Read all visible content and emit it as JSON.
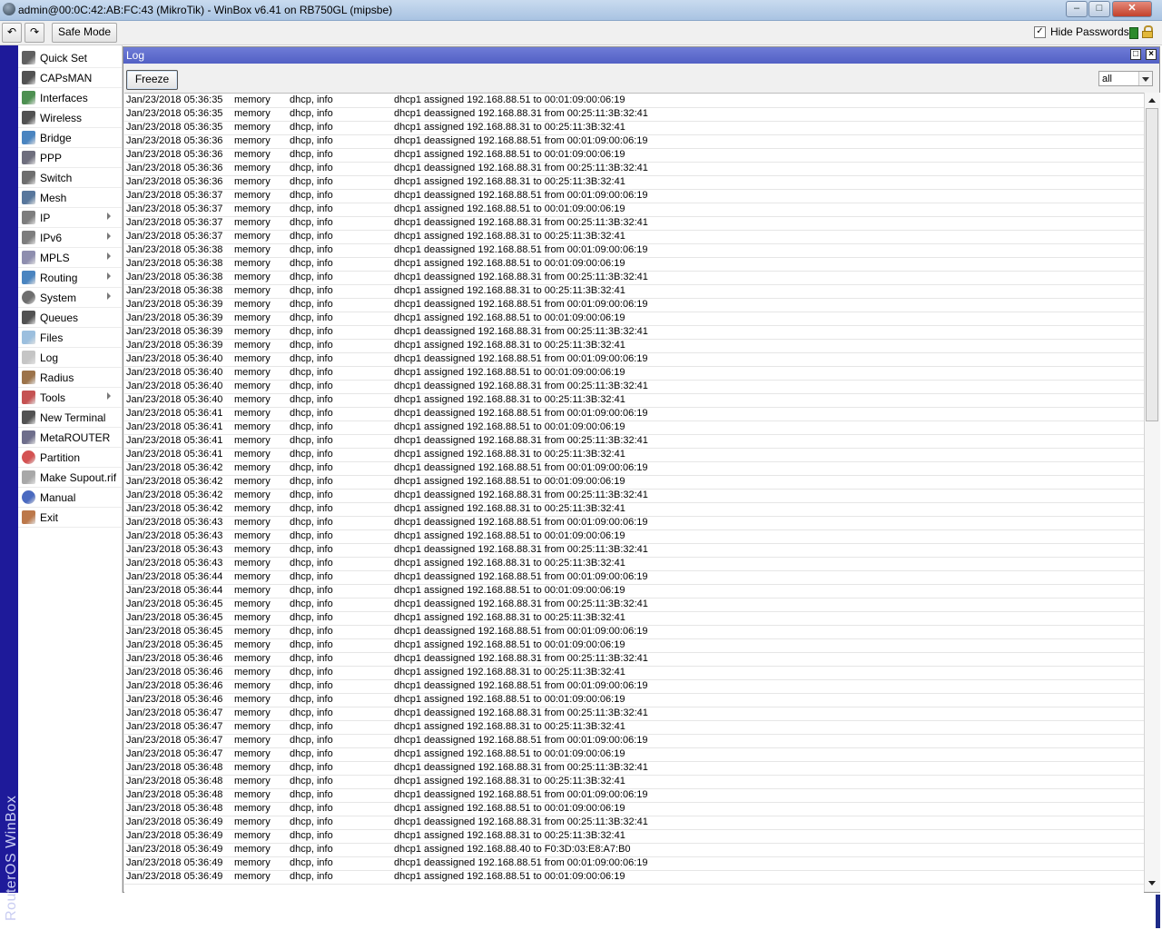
{
  "window": {
    "title": "admin@00:0C:42:AB:FC:43 (MikroTik) - WinBox v6.41 on RB750GL (mipsbe)",
    "minimize_icon": "minimize-icon",
    "maximize_icon": "maximize-icon",
    "close_icon": "close-icon"
  },
  "toolbar": {
    "undo_icon": "undo-icon",
    "redo_icon": "redo-icon",
    "safe_mode_label": "Safe Mode",
    "hide_passwords_label": "Hide Passwords",
    "hide_passwords_checked": true
  },
  "brand": {
    "text": "RouterOS WinBox"
  },
  "sidebar": {
    "items": [
      {
        "label": "Quick Set",
        "icon": "wand-icon",
        "submenu": false
      },
      {
        "label": "CAPsMAN",
        "icon": "antenna-icon",
        "submenu": false
      },
      {
        "label": "Interfaces",
        "icon": "interfaces-icon",
        "submenu": false
      },
      {
        "label": "Wireless",
        "icon": "wireless-icon",
        "submenu": false
      },
      {
        "label": "Bridge",
        "icon": "bridge-icon",
        "submenu": false
      },
      {
        "label": "PPP",
        "icon": "ppp-icon",
        "submenu": false
      },
      {
        "label": "Switch",
        "icon": "switch-icon",
        "submenu": false
      },
      {
        "label": "Mesh",
        "icon": "mesh-icon",
        "submenu": false
      },
      {
        "label": "IP",
        "icon": "ip-icon",
        "submenu": true
      },
      {
        "label": "IPv6",
        "icon": "ipv6-icon",
        "submenu": true
      },
      {
        "label": "MPLS",
        "icon": "mpls-icon",
        "submenu": true
      },
      {
        "label": "Routing",
        "icon": "routing-icon",
        "submenu": true
      },
      {
        "label": "System",
        "icon": "gear-icon",
        "submenu": true
      },
      {
        "label": "Queues",
        "icon": "queues-icon",
        "submenu": false
      },
      {
        "label": "Files",
        "icon": "folder-icon",
        "submenu": false
      },
      {
        "label": "Log",
        "icon": "log-icon",
        "submenu": false
      },
      {
        "label": "Radius",
        "icon": "radius-icon",
        "submenu": false
      },
      {
        "label": "Tools",
        "icon": "tools-icon",
        "submenu": true
      },
      {
        "label": "New Terminal",
        "icon": "terminal-icon",
        "submenu": false
      },
      {
        "label": "MetaROUTER",
        "icon": "metarouter-icon",
        "submenu": false
      },
      {
        "label": "Partition",
        "icon": "partition-icon",
        "submenu": false
      },
      {
        "label": "Make Supout.rif",
        "icon": "supout-icon",
        "submenu": false
      },
      {
        "label": "Manual",
        "icon": "help-icon",
        "submenu": false
      },
      {
        "label": "Exit",
        "icon": "exit-icon",
        "submenu": false
      }
    ]
  },
  "log_window": {
    "title": "Log",
    "freeze_label": "Freeze",
    "filter_value": "all",
    "rows": [
      [
        "Jan/23/2018 05:36:35",
        "memory",
        "dhcp, info",
        "dhcp1 assigned 192.168.88.51 to 00:01:09:00:06:19"
      ],
      [
        "Jan/23/2018 05:36:35",
        "memory",
        "dhcp, info",
        "dhcp1 deassigned 192.168.88.31 from 00:25:11:3B:32:41"
      ],
      [
        "Jan/23/2018 05:36:35",
        "memory",
        "dhcp, info",
        "dhcp1 assigned 192.168.88.31 to 00:25:11:3B:32:41"
      ],
      [
        "Jan/23/2018 05:36:36",
        "memory",
        "dhcp, info",
        "dhcp1 deassigned 192.168.88.51 from 00:01:09:00:06:19"
      ],
      [
        "Jan/23/2018 05:36:36",
        "memory",
        "dhcp, info",
        "dhcp1 assigned 192.168.88.51 to 00:01:09:00:06:19"
      ],
      [
        "Jan/23/2018 05:36:36",
        "memory",
        "dhcp, info",
        "dhcp1 deassigned 192.168.88.31 from 00:25:11:3B:32:41"
      ],
      [
        "Jan/23/2018 05:36:36",
        "memory",
        "dhcp, info",
        "dhcp1 assigned 192.168.88.31 to 00:25:11:3B:32:41"
      ],
      [
        "Jan/23/2018 05:36:37",
        "memory",
        "dhcp, info",
        "dhcp1 deassigned 192.168.88.51 from 00:01:09:00:06:19"
      ],
      [
        "Jan/23/2018 05:36:37",
        "memory",
        "dhcp, info",
        "dhcp1 assigned 192.168.88.51 to 00:01:09:00:06:19"
      ],
      [
        "Jan/23/2018 05:36:37",
        "memory",
        "dhcp, info",
        "dhcp1 deassigned 192.168.88.31 from 00:25:11:3B:32:41"
      ],
      [
        "Jan/23/2018 05:36:37",
        "memory",
        "dhcp, info",
        "dhcp1 assigned 192.168.88.31 to 00:25:11:3B:32:41"
      ],
      [
        "Jan/23/2018 05:36:38",
        "memory",
        "dhcp, info",
        "dhcp1 deassigned 192.168.88.51 from 00:01:09:00:06:19"
      ],
      [
        "Jan/23/2018 05:36:38",
        "memory",
        "dhcp, info",
        "dhcp1 assigned 192.168.88.51 to 00:01:09:00:06:19"
      ],
      [
        "Jan/23/2018 05:36:38",
        "memory",
        "dhcp, info",
        "dhcp1 deassigned 192.168.88.31 from 00:25:11:3B:32:41"
      ],
      [
        "Jan/23/2018 05:36:38",
        "memory",
        "dhcp, info",
        "dhcp1 assigned 192.168.88.31 to 00:25:11:3B:32:41"
      ],
      [
        "Jan/23/2018 05:36:39",
        "memory",
        "dhcp, info",
        "dhcp1 deassigned 192.168.88.51 from 00:01:09:00:06:19"
      ],
      [
        "Jan/23/2018 05:36:39",
        "memory",
        "dhcp, info",
        "dhcp1 assigned 192.168.88.51 to 00:01:09:00:06:19"
      ],
      [
        "Jan/23/2018 05:36:39",
        "memory",
        "dhcp, info",
        "dhcp1 deassigned 192.168.88.31 from 00:25:11:3B:32:41"
      ],
      [
        "Jan/23/2018 05:36:39",
        "memory",
        "dhcp, info",
        "dhcp1 assigned 192.168.88.31 to 00:25:11:3B:32:41"
      ],
      [
        "Jan/23/2018 05:36:40",
        "memory",
        "dhcp, info",
        "dhcp1 deassigned 192.168.88.51 from 00:01:09:00:06:19"
      ],
      [
        "Jan/23/2018 05:36:40",
        "memory",
        "dhcp, info",
        "dhcp1 assigned 192.168.88.51 to 00:01:09:00:06:19"
      ],
      [
        "Jan/23/2018 05:36:40",
        "memory",
        "dhcp, info",
        "dhcp1 deassigned 192.168.88.31 from 00:25:11:3B:32:41"
      ],
      [
        "Jan/23/2018 05:36:40",
        "memory",
        "dhcp, info",
        "dhcp1 assigned 192.168.88.31 to 00:25:11:3B:32:41"
      ],
      [
        "Jan/23/2018 05:36:41",
        "memory",
        "dhcp, info",
        "dhcp1 deassigned 192.168.88.51 from 00:01:09:00:06:19"
      ],
      [
        "Jan/23/2018 05:36:41",
        "memory",
        "dhcp, info",
        "dhcp1 assigned 192.168.88.51 to 00:01:09:00:06:19"
      ],
      [
        "Jan/23/2018 05:36:41",
        "memory",
        "dhcp, info",
        "dhcp1 deassigned 192.168.88.31 from 00:25:11:3B:32:41"
      ],
      [
        "Jan/23/2018 05:36:41",
        "memory",
        "dhcp, info",
        "dhcp1 assigned 192.168.88.31 to 00:25:11:3B:32:41"
      ],
      [
        "Jan/23/2018 05:36:42",
        "memory",
        "dhcp, info",
        "dhcp1 deassigned 192.168.88.51 from 00:01:09:00:06:19"
      ],
      [
        "Jan/23/2018 05:36:42",
        "memory",
        "dhcp, info",
        "dhcp1 assigned 192.168.88.51 to 00:01:09:00:06:19"
      ],
      [
        "Jan/23/2018 05:36:42",
        "memory",
        "dhcp, info",
        "dhcp1 deassigned 192.168.88.31 from 00:25:11:3B:32:41"
      ],
      [
        "Jan/23/2018 05:36:42",
        "memory",
        "dhcp, info",
        "dhcp1 assigned 192.168.88.31 to 00:25:11:3B:32:41"
      ],
      [
        "Jan/23/2018 05:36:43",
        "memory",
        "dhcp, info",
        "dhcp1 deassigned 192.168.88.51 from 00:01:09:00:06:19"
      ],
      [
        "Jan/23/2018 05:36:43",
        "memory",
        "dhcp, info",
        "dhcp1 assigned 192.168.88.51 to 00:01:09:00:06:19"
      ],
      [
        "Jan/23/2018 05:36:43",
        "memory",
        "dhcp, info",
        "dhcp1 deassigned 192.168.88.31 from 00:25:11:3B:32:41"
      ],
      [
        "Jan/23/2018 05:36:43",
        "memory",
        "dhcp, info",
        "dhcp1 assigned 192.168.88.31 to 00:25:11:3B:32:41"
      ],
      [
        "Jan/23/2018 05:36:44",
        "memory",
        "dhcp, info",
        "dhcp1 deassigned 192.168.88.51 from 00:01:09:00:06:19"
      ],
      [
        "Jan/23/2018 05:36:44",
        "memory",
        "dhcp, info",
        "dhcp1 assigned 192.168.88.51 to 00:01:09:00:06:19"
      ],
      [
        "Jan/23/2018 05:36:45",
        "memory",
        "dhcp, info",
        "dhcp1 deassigned 192.168.88.31 from 00:25:11:3B:32:41"
      ],
      [
        "Jan/23/2018 05:36:45",
        "memory",
        "dhcp, info",
        "dhcp1 assigned 192.168.88.31 to 00:25:11:3B:32:41"
      ],
      [
        "Jan/23/2018 05:36:45",
        "memory",
        "dhcp, info",
        "dhcp1 deassigned 192.168.88.51 from 00:01:09:00:06:19"
      ],
      [
        "Jan/23/2018 05:36:45",
        "memory",
        "dhcp, info",
        "dhcp1 assigned 192.168.88.51 to 00:01:09:00:06:19"
      ],
      [
        "Jan/23/2018 05:36:46",
        "memory",
        "dhcp, info",
        "dhcp1 deassigned 192.168.88.31 from 00:25:11:3B:32:41"
      ],
      [
        "Jan/23/2018 05:36:46",
        "memory",
        "dhcp, info",
        "dhcp1 assigned 192.168.88.31 to 00:25:11:3B:32:41"
      ],
      [
        "Jan/23/2018 05:36:46",
        "memory",
        "dhcp, info",
        "dhcp1 deassigned 192.168.88.51 from 00:01:09:00:06:19"
      ],
      [
        "Jan/23/2018 05:36:46",
        "memory",
        "dhcp, info",
        "dhcp1 assigned 192.168.88.51 to 00:01:09:00:06:19"
      ],
      [
        "Jan/23/2018 05:36:47",
        "memory",
        "dhcp, info",
        "dhcp1 deassigned 192.168.88.31 from 00:25:11:3B:32:41"
      ],
      [
        "Jan/23/2018 05:36:47",
        "memory",
        "dhcp, info",
        "dhcp1 assigned 192.168.88.31 to 00:25:11:3B:32:41"
      ],
      [
        "Jan/23/2018 05:36:47",
        "memory",
        "dhcp, info",
        "dhcp1 deassigned 192.168.88.51 from 00:01:09:00:06:19"
      ],
      [
        "Jan/23/2018 05:36:47",
        "memory",
        "dhcp, info",
        "dhcp1 assigned 192.168.88.51 to 00:01:09:00:06:19"
      ],
      [
        "Jan/23/2018 05:36:48",
        "memory",
        "dhcp, info",
        "dhcp1 deassigned 192.168.88.31 from 00:25:11:3B:32:41"
      ],
      [
        "Jan/23/2018 05:36:48",
        "memory",
        "dhcp, info",
        "dhcp1 assigned 192.168.88.31 to 00:25:11:3B:32:41"
      ],
      [
        "Jan/23/2018 05:36:48",
        "memory",
        "dhcp, info",
        "dhcp1 deassigned 192.168.88.51 from 00:01:09:00:06:19"
      ],
      [
        "Jan/23/2018 05:36:48",
        "memory",
        "dhcp, info",
        "dhcp1 assigned 192.168.88.51 to 00:01:09:00:06:19"
      ],
      [
        "Jan/23/2018 05:36:49",
        "memory",
        "dhcp, info",
        "dhcp1 deassigned 192.168.88.31 from 00:25:11:3B:32:41"
      ],
      [
        "Jan/23/2018 05:36:49",
        "memory",
        "dhcp, info",
        "dhcp1 assigned 192.168.88.31 to 00:25:11:3B:32:41"
      ],
      [
        "Jan/23/2018 05:36:49",
        "memory",
        "dhcp, info",
        "dhcp1 assigned 192.168.88.40 to F0:3D:03:E8:A7:B0"
      ],
      [
        "Jan/23/2018 05:36:49",
        "memory",
        "dhcp, info",
        "dhcp1 deassigned 192.168.88.51 from 00:01:09:00:06:19"
      ],
      [
        "Jan/23/2018 05:36:49",
        "memory",
        "dhcp, info",
        "dhcp1 assigned 192.168.88.51 to 00:01:09:00:06:19"
      ]
    ]
  },
  "colors": {
    "brand_bar": "#1e1a9a",
    "window_titlebar": "#5f6dcf",
    "status_indicator": "#2b8a2b"
  }
}
